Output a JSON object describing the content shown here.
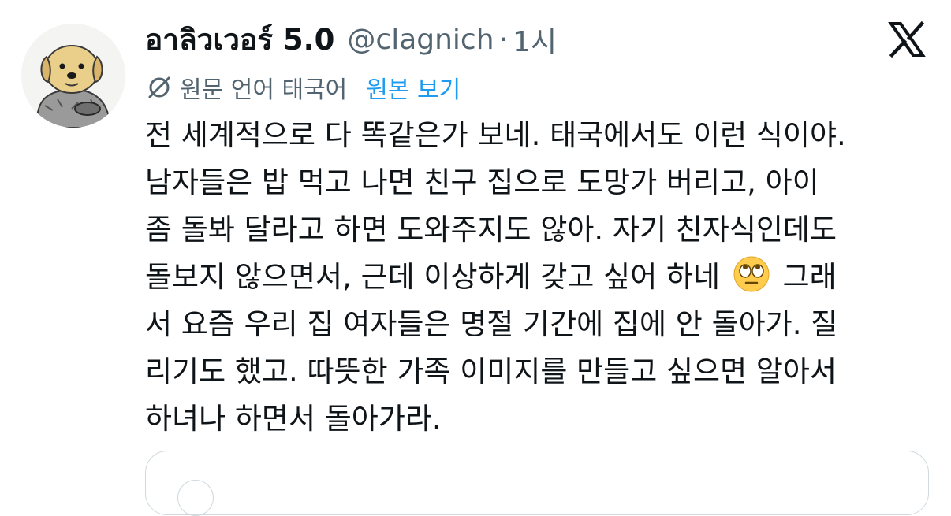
{
  "post": {
    "display_name": "อาลิวเวอร์ 5.0",
    "handle": "@clagnich",
    "separator": "·",
    "time": "1시",
    "translation_note": "원문 언어 태국어",
    "view_original": "원본 보기",
    "body_lines": [
      "전 세계적으로 다 똑같은가 보네. 태국에서도 이런 식이야.",
      "남자들은 밥 먹고 나면 친구 집으로 도망가 버리고, 아이",
      "좀 돌봐 달라고 하면 도와주지도 않아. 자기 친자식인데도",
      "돌보지 않으면서, 근데 이상하게 갖고 싶어 하네",
      "그래",
      "서 요즘 우리 집 여자들은 명절 기간에 집에 안 돌아가. 질",
      "리기도 했고. 따뜻한 가족 이미지를 만들고 싶으면 알아서",
      "하녀나 하면서 돌아가라."
    ],
    "emoji": "face-with-rolling-eyes"
  },
  "icons": {
    "logo": "x-logo-icon",
    "translate": "translate-icon",
    "avatar": "dog-avatar"
  },
  "colors": {
    "text_primary": "#0f1419",
    "text_secondary": "#536471",
    "link": "#1d9bf0",
    "border": "#cfd9de"
  }
}
